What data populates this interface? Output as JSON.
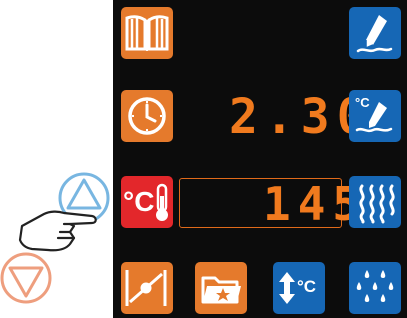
{
  "display": {
    "time_value": "2.30",
    "temperature_value": "145"
  },
  "buttons": {
    "temp_badge": "°C",
    "core_probe_label": "°C"
  },
  "icons": {
    "book": "book-icon",
    "clock": "clock-icon",
    "temperature": "temperature-icon",
    "pen": "pen-icon",
    "temp_edit": "temperature-edit-icon",
    "steam": "steam-icon",
    "probe": "probe-icon",
    "folder": "folder-star-icon",
    "arrows_temp": "up-down-temperature-icon",
    "drops": "water-drops-icon"
  },
  "colors": {
    "orange": "#e57a2c",
    "blue": "#1667b5",
    "red": "#e3272b",
    "readout": "#f07a1e",
    "background": "#0c0c0c"
  }
}
